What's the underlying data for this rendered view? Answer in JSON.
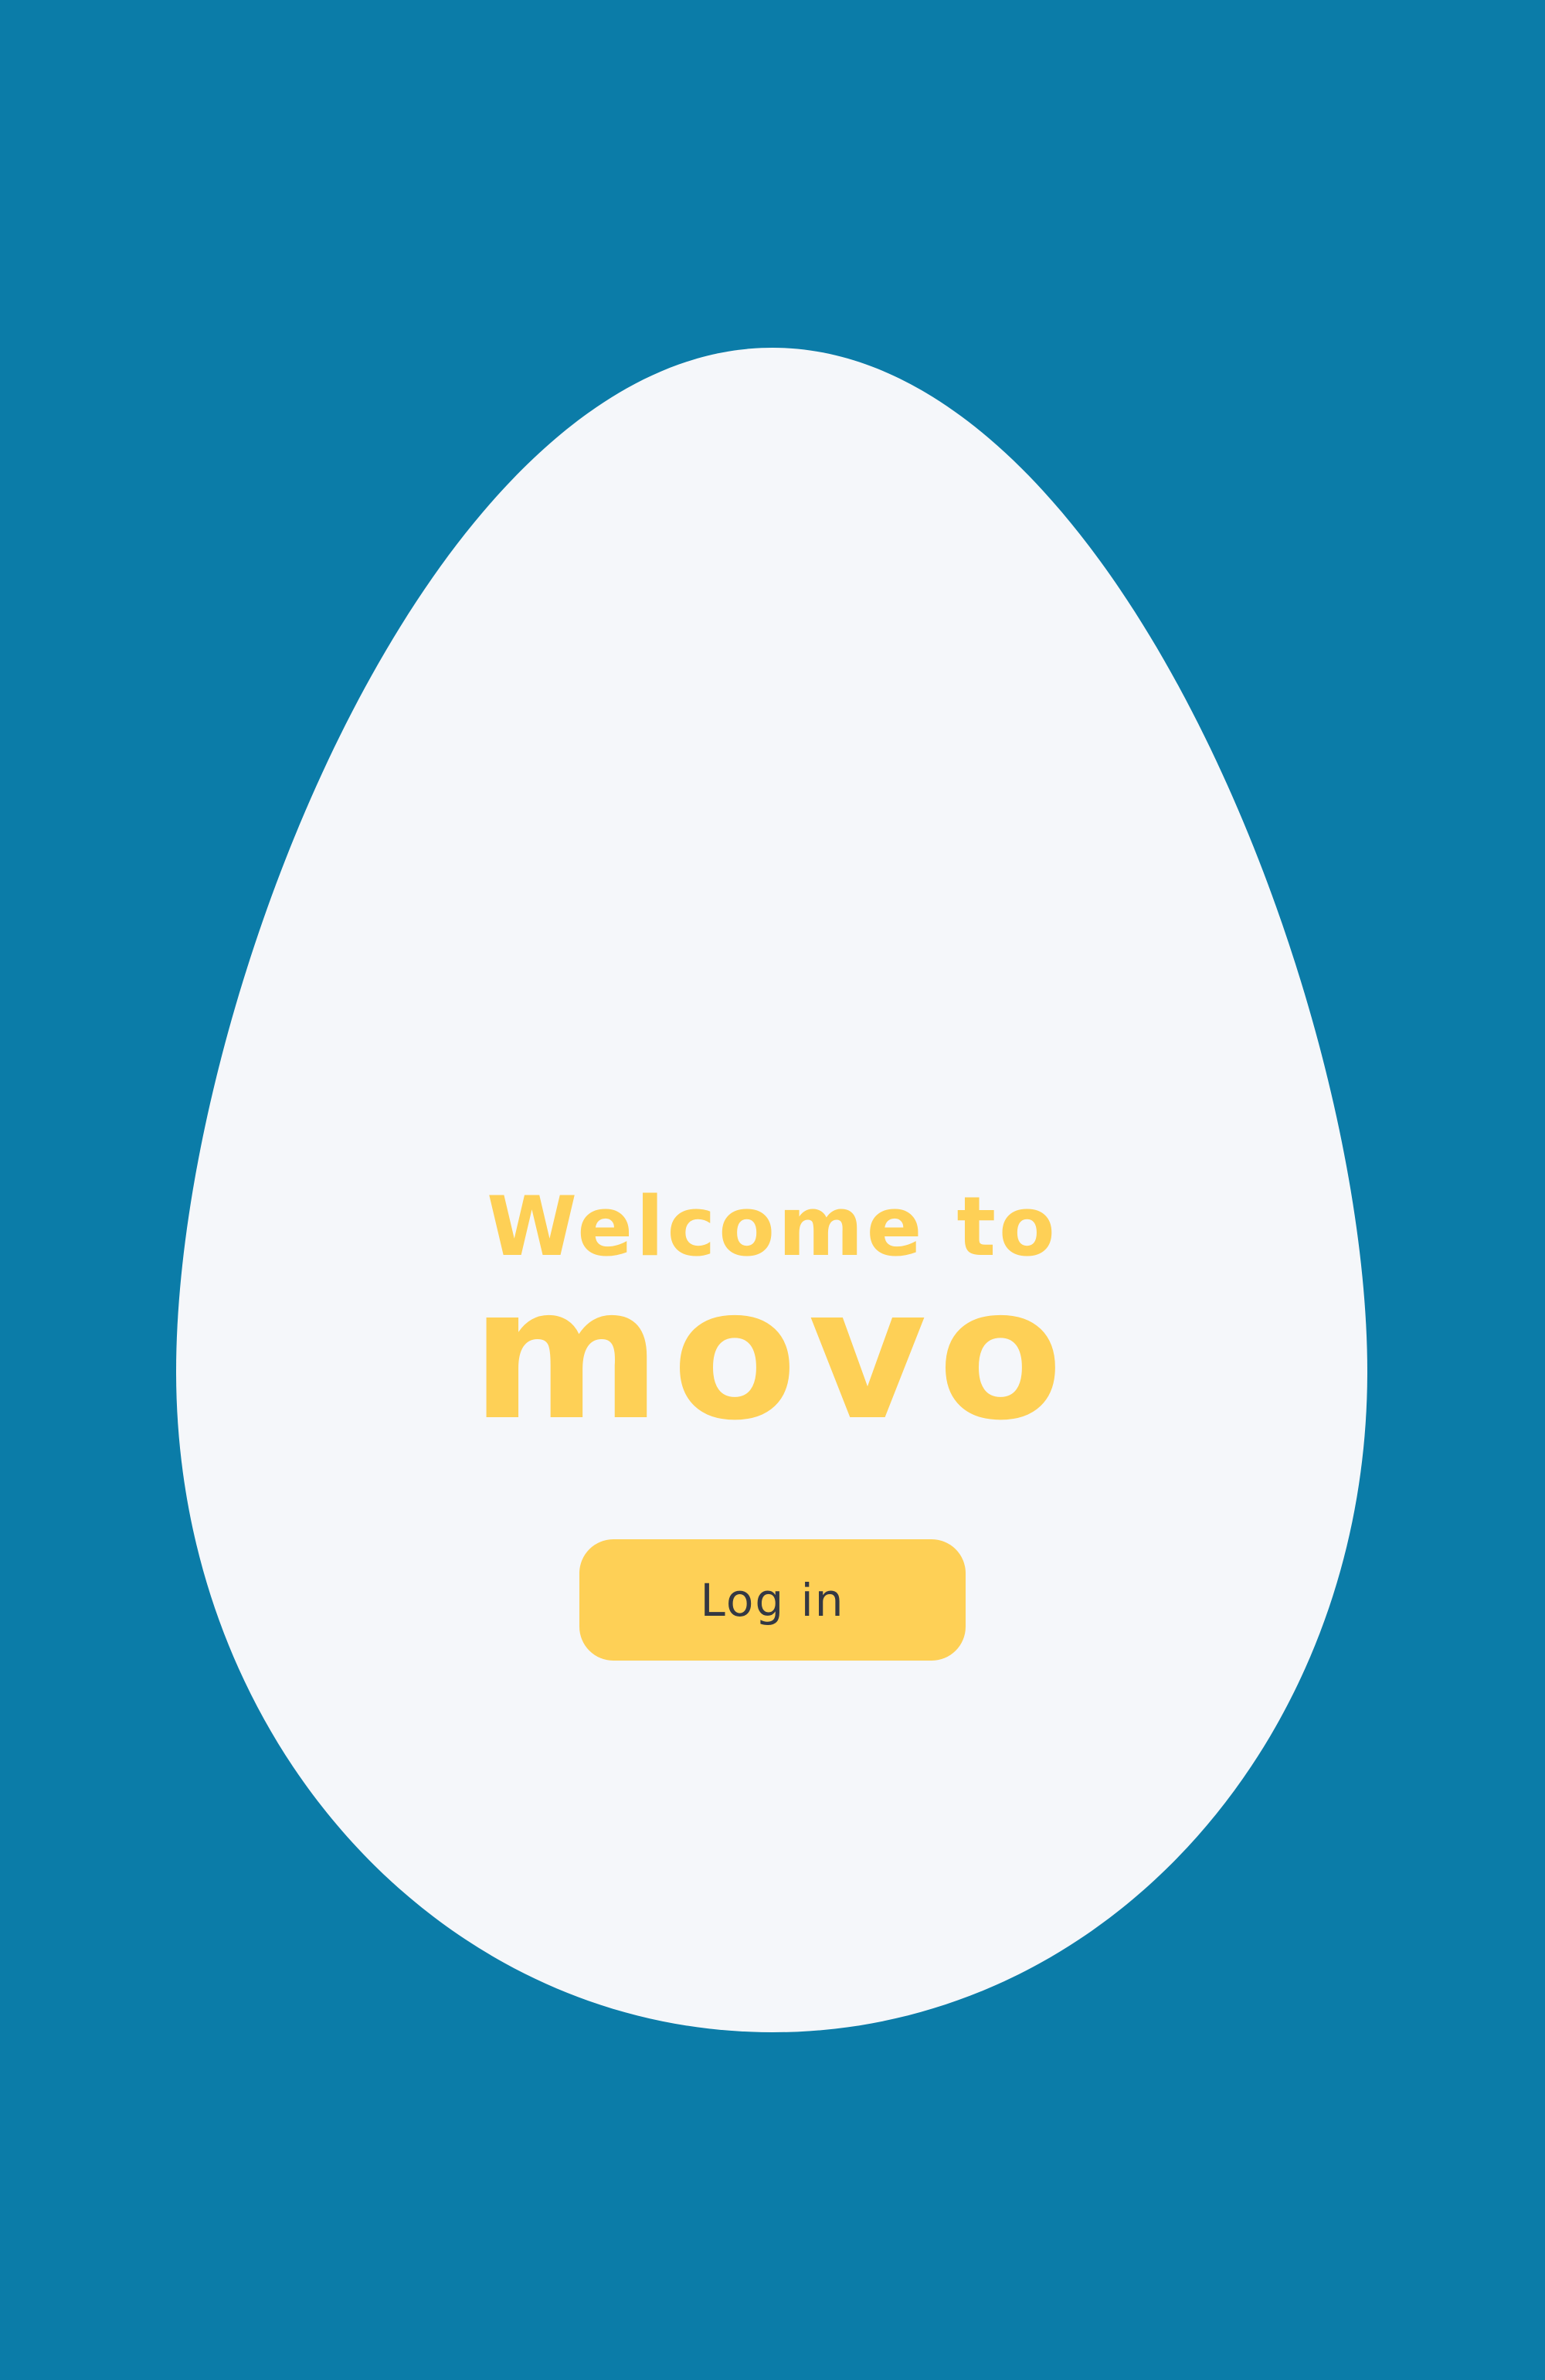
{
  "welcome": {
    "title": "Welcome to",
    "brand": "movo"
  },
  "actions": {
    "login_label": "Log in"
  },
  "colors": {
    "background": "#0b7ca8",
    "egg": "#f5f7fa",
    "accent": "#fed056",
    "button_text": "#333843"
  }
}
